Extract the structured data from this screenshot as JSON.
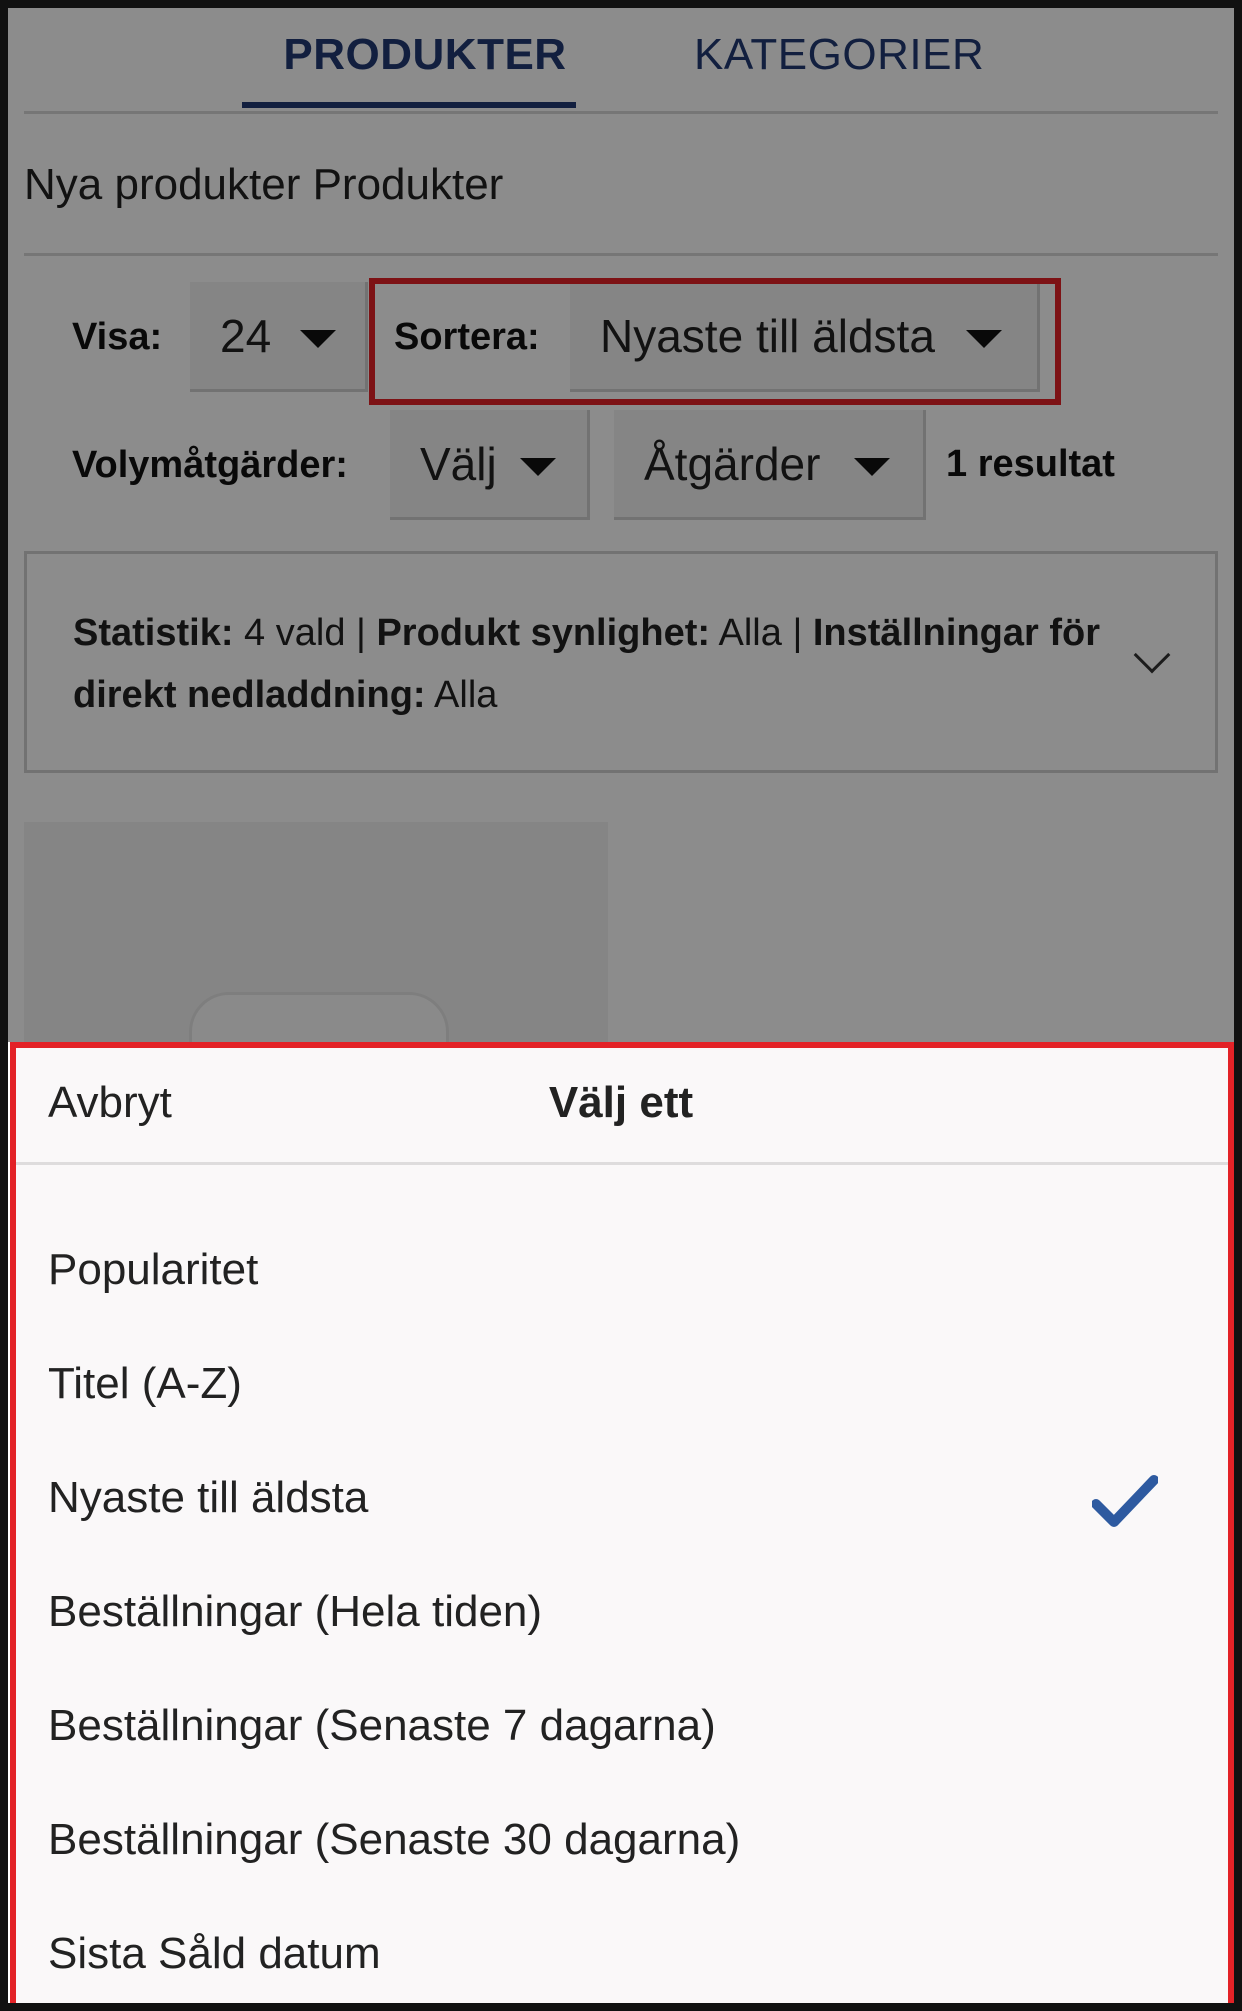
{
  "tabs": {
    "products": "PRODUKTER",
    "categories": "KATEGORIER"
  },
  "breadcrumb": "Nya produkter Produkter",
  "controls": {
    "show_label": "Visa:",
    "show_value": "24",
    "sort_label": "Sortera:",
    "sort_value": "Nyaste till äldsta",
    "bulk_label": "Volymåtgärder:",
    "bulk_value": "Välj",
    "actions_value": "Åtgärder",
    "result_count": "1 resultat"
  },
  "stats": {
    "statistik_label": "Statistik:",
    "statistik_value": "4 vald",
    "separator": "|",
    "visibility_label": "Produkt synlighet:",
    "visibility_value": "Alla",
    "download_label": "Inställningar för direkt nedladdning:",
    "download_value": "Alla"
  },
  "picker": {
    "cancel": "Avbryt",
    "title": "Välj ett",
    "options": [
      "Popularitet",
      "Titel (A-Z)",
      "Nyaste till äldsta",
      "Beställningar (Hela tiden)",
      "Beställningar (Senaste 7 dagarna)",
      "Beställningar (Senaste 30 dagarna)",
      "Sista Såld datum"
    ],
    "selected_index": 2,
    "check_color": "#2e5aa0"
  },
  "colors": {
    "accent": "#213a73",
    "highlight": "#e32227"
  }
}
